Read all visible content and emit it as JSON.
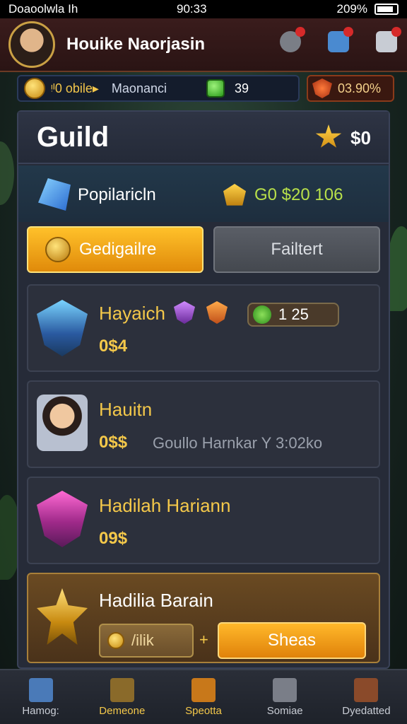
{
  "status": {
    "left": "Doaoolwla Ih",
    "time": "90:33",
    "battery": "209%"
  },
  "header": {
    "player_name": "Houike Naorjasin"
  },
  "resources": {
    "gold_text": "ᵎᴵ0 obile▸",
    "label": "Maonanci",
    "green_value": "39",
    "right_value": "03.90%"
  },
  "panel": {
    "title": "Guild",
    "star_value": "$0",
    "popularity_label": "Popilaricln",
    "popularity_value": "G0 $20 106"
  },
  "tabs": {
    "active": "Gedigailre",
    "inactive": "Failtert"
  },
  "entries": [
    {
      "name": "Hayaich",
      "sub": "0$4",
      "pill_value": "1 25"
    },
    {
      "name": "Hauitn",
      "sub": "0$$",
      "extra": "Goullo Harnkar Y 3:02ko"
    },
    {
      "name": "Hadilah Hariann",
      "sub": "09$"
    },
    {
      "name": "Hadilia Barain",
      "left_button": "/ilik",
      "plus": "+",
      "right_button": "Sheas"
    }
  ],
  "nav": [
    {
      "label": "Hamog:",
      "icon": "home-icon"
    },
    {
      "label": "Demeone",
      "icon": "shield-icon"
    },
    {
      "label": "Speotta",
      "icon": "scroll-icon"
    },
    {
      "label": "Somiae",
      "icon": "puzzle-icon"
    },
    {
      "label": "Dyedatted",
      "icon": "chest-icon"
    }
  ]
}
